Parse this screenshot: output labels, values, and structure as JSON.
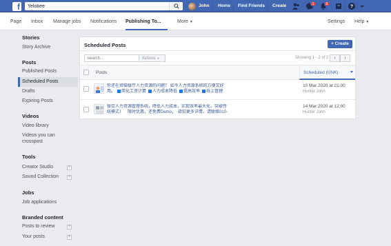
{
  "topbar": {
    "search_value": "Yelobee",
    "user_name": "John",
    "nav": [
      "Home",
      "Find Friends",
      "Create"
    ],
    "messages_badge": "1",
    "notifications_badge": "8"
  },
  "page_nav": {
    "items": [
      "Page",
      "Inbox",
      "Manage jobs",
      "Notifications",
      "Publishing To...",
      "More"
    ],
    "right": [
      "Settings",
      "Help"
    ]
  },
  "sidebar": {
    "sections": [
      {
        "title": "Stories",
        "items": [
          "Story Archive"
        ]
      },
      {
        "title": "Posts",
        "items": [
          "Published Posts",
          "Scheduled Posts",
          "Drafts",
          "Expiring Posts"
        ]
      },
      {
        "title": "Videos",
        "items": [
          "Video library",
          "Videos you can",
          "crosspost"
        ]
      },
      {
        "title": "Tools",
        "items": [
          "Creator Studio",
          "Sound Collection"
        ]
      },
      {
        "title": "Jobs",
        "items": [
          "Job applications"
        ]
      },
      {
        "title": "Branded content",
        "items": [
          "Posts to review",
          "Your posts"
        ]
      }
    ]
  },
  "panel": {
    "title": "Scheduled Posts",
    "create_label": "+ Create",
    "search_placeholder": "Search...",
    "actions_label": "Actions",
    "showing": "Showing 1 - 2 of 2",
    "col_posts": "Posts",
    "col_scheduled": "Scheduled (UNK)",
    "rows": [
      {
        "line1": "你还在烦恼餐厅人力资源的问题？ 如今人力资源系统的方便又好",
        "line2_lead": "用。",
        "tags": [
          "简化工资计算",
          "人力成本降低",
          "提高效率",
          "线上管理"
        ],
        "when": "10 Mar 2020 at 21:00",
        "who": "Hunter John"
      },
      {
        "line1": "餐饮人力资源管理系统，降低人力成本，实现效率最大化，突破传",
        "line2_lead": "统模式！　限时优惠，还免费Demo，　欲知更多详情，请联络010-",
        "tags": [],
        "when": "14 Mar 2020 at 12:00",
        "who": "Hunter John"
      }
    ]
  }
}
